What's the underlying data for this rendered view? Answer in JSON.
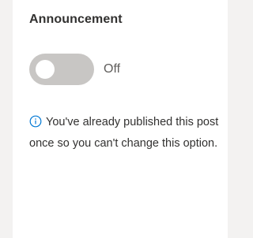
{
  "section": {
    "title": "Announcement"
  },
  "toggle": {
    "state_label": "Off",
    "checked": false
  },
  "notice": {
    "icon": "info-icon",
    "text": "You've already published this post once so you can't change this option."
  },
  "colors": {
    "background": "#f3f2f1",
    "panel": "#ffffff",
    "toggle_track": "#c8c6c4",
    "info_icon": "#0078d4",
    "text": "#323130"
  }
}
